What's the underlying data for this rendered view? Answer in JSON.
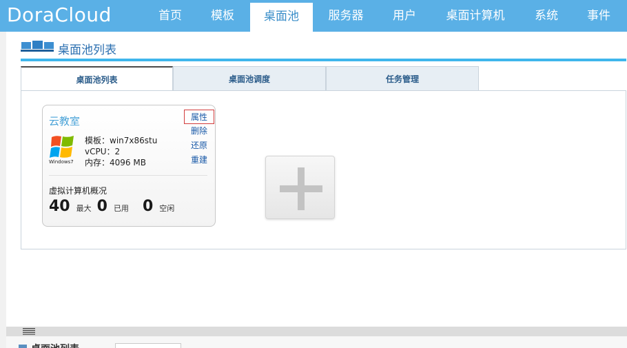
{
  "app": {
    "logo": "DoraCloud"
  },
  "nav": {
    "items": [
      {
        "label": "首页"
      },
      {
        "label": "模板"
      },
      {
        "label": "桌面池",
        "active": true
      },
      {
        "label": "服务器"
      },
      {
        "label": "用户"
      },
      {
        "label": "桌面计算机"
      },
      {
        "label": "系统"
      },
      {
        "label": "事件"
      }
    ]
  },
  "section": {
    "title": "桌面池列表"
  },
  "tabs": [
    {
      "label": "桌面池列表",
      "active": true
    },
    {
      "label": "桌面池调度"
    },
    {
      "label": "任务管理"
    }
  ],
  "pool_card": {
    "name": "云教室",
    "template": "模板：win7x86stu",
    "vcpu": "vCPU：2",
    "memory": "内存：4096 MB",
    "os_logo_text": "Windows7",
    "actions": [
      "属性",
      "删除",
      "还原",
      "重建"
    ],
    "vm_label": "虚拟计算机概况",
    "stats": {
      "max": "40",
      "max_label": "最大",
      "used": "0",
      "used_label": "已用",
      "idle": "0",
      "idle_label": "空闲"
    }
  },
  "colors": {
    "nav_bg": "#5ab0e6",
    "accent_line": "#3fb6ec",
    "link": "#1a5aa8",
    "highlight_border": "#d23c3c"
  },
  "bottom": {
    "title": "桌面池列表"
  }
}
